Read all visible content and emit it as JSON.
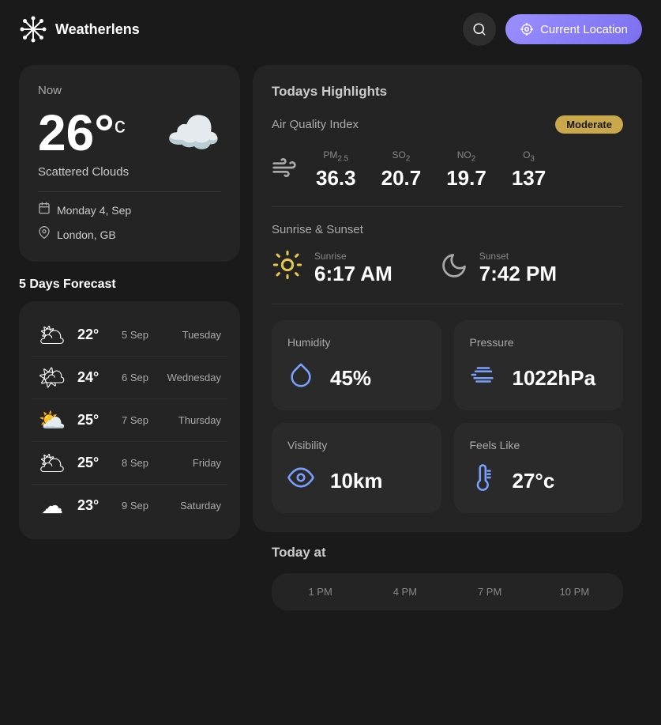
{
  "header": {
    "logo_text": "Weatherlens",
    "search_label": "Search",
    "location_btn": "Current Location"
  },
  "now_card": {
    "label": "Now",
    "temperature": "26°",
    "unit": "c",
    "condition": "Scattered Clouds",
    "date": "Monday 4, Sep",
    "location": "London, GB"
  },
  "forecast": {
    "title": "5 Days Forecast",
    "items": [
      {
        "temp": "22°",
        "date": "5 Sep",
        "day": "Tuesday",
        "icon": "🌥"
      },
      {
        "temp": "24°",
        "date": "6 Sep",
        "day": "Wednesday",
        "icon": "🌤"
      },
      {
        "temp": "25°",
        "date": "7 Sep",
        "day": "Thursday",
        "icon": "⛅"
      },
      {
        "temp": "25°",
        "date": "8 Sep",
        "day": "Friday",
        "icon": "🌥"
      },
      {
        "temp": "23°",
        "date": "9 Sep",
        "day": "Saturday",
        "icon": "☁"
      }
    ]
  },
  "highlights": {
    "title": "Todays Highlights",
    "aqi": {
      "label": "Air Quality Index",
      "badge": "Moderate",
      "metrics": [
        {
          "label": "PM2.5",
          "sub": "2.5",
          "value": "36.3"
        },
        {
          "label": "SO₂",
          "sub": "2",
          "value": "20.7"
        },
        {
          "label": "NO₂",
          "sub": "2",
          "value": "19.7"
        },
        {
          "label": "O₃",
          "sub": "3",
          "value": "137"
        }
      ]
    },
    "sunrise_sunset": {
      "label": "Sunrise & Sunset",
      "sunrise_label": "Sunrise",
      "sunrise_time": "6:17 AM",
      "sunset_label": "Sunset",
      "sunset_time": "7:42 PM"
    },
    "humidity": {
      "label": "Humidity",
      "value": "45%"
    },
    "pressure": {
      "label": "Pressure",
      "value": "1022hPa"
    },
    "visibility": {
      "label": "Visibility",
      "value": "10km"
    },
    "feels_like": {
      "label": "Feels Like",
      "value": "27°c"
    }
  },
  "today_at": {
    "title": "Today at",
    "hours": [
      {
        "time": "1 PM"
      },
      {
        "time": "4 PM"
      },
      {
        "time": "7 PM"
      },
      {
        "time": "10 PM"
      }
    ]
  }
}
